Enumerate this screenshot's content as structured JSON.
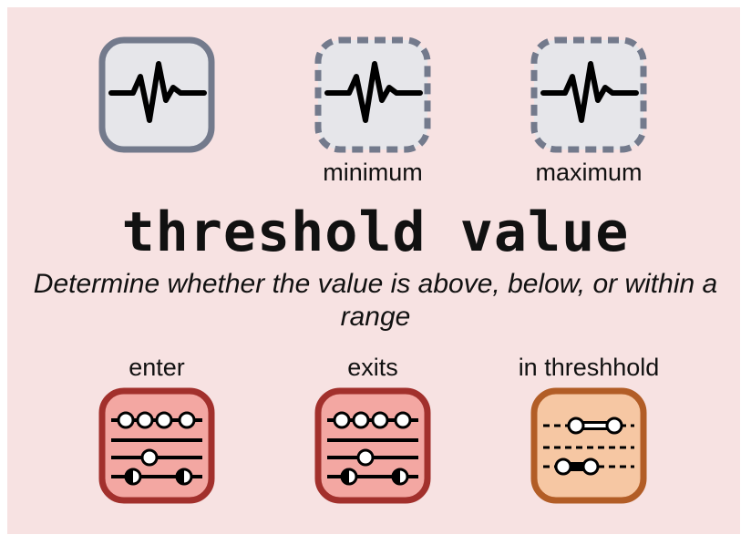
{
  "title": "threshold value",
  "subtitle": "Determine whether the value is above, below, or within a range",
  "top_icons": [
    {
      "icon": "pulse-icon",
      "label": "",
      "border": "solid"
    },
    {
      "icon": "pulse-icon",
      "label": "minimum",
      "border": "dashed"
    },
    {
      "icon": "pulse-icon",
      "label": "maximum",
      "border": "dashed"
    }
  ],
  "bottom_icons": [
    {
      "icon": "sliders-icon",
      "label": "enter"
    },
    {
      "icon": "sliders-icon",
      "label": "exits"
    },
    {
      "icon": "range-slider-icon",
      "label": "in threshhold"
    }
  ],
  "colors": {
    "background": "#f7e2e2",
    "gray_fill": "#e6e6ea",
    "gray_border": "#737a8c",
    "red_fill": "#f3a7a2",
    "red_border": "#a2302c",
    "orange_fill": "#f6c7a3",
    "orange_border": "#b25d26"
  }
}
